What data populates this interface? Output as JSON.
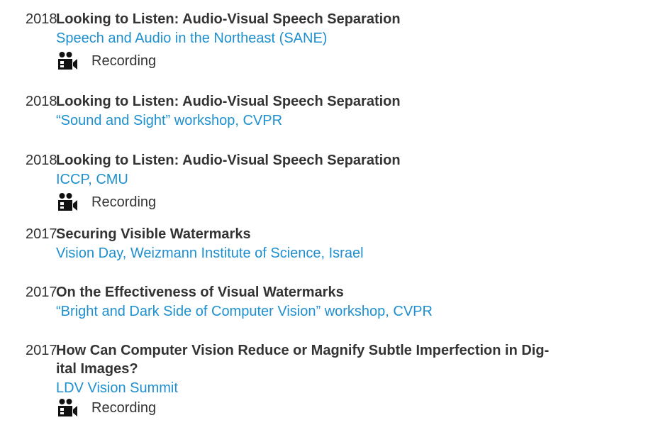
{
  "talks": [
    {
      "year": "2018",
      "title": "Looking to Listen: Audio-Visual Speech Separation",
      "venue": "Speech and Audio in the Northeast (SANE)",
      "recording": "Recording"
    },
    {
      "year": "2018",
      "title": "Looking to Listen: Audio-Visual Speech Separation",
      "venue": "“Sound and Sight” workshop, CVPR"
    },
    {
      "year": "2018",
      "title": "Looking to Listen: Audio-Visual Speech Separation",
      "venue": "ICCP, CMU",
      "recording": "Recording"
    },
    {
      "year": "2017",
      "title": "Securing Visible Watermarks",
      "venue": "Vision Day, Weizmann Institute of Science, Israel"
    },
    {
      "year": "2017",
      "title": "On the Effectiveness of Visual Watermarks",
      "venue": "“Bright and Dark Side of Computer Vision” workshop, CVPR"
    },
    {
      "year": "2017",
      "title": "How Can Computer Vision Reduce or Magnify Subtle Imperfection in Dig-ital Images?",
      "venue": "LDV Vision Summit",
      "recording": "Recording"
    }
  ],
  "icons": {
    "recording": "video-camera-icon"
  },
  "colors": {
    "text": "#333333",
    "link": "#1e90d0"
  }
}
